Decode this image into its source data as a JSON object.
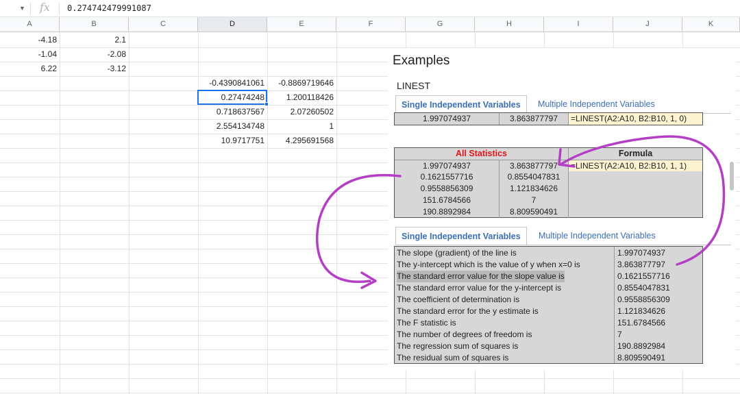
{
  "formula_bar": {
    "fx_label": "fx",
    "value": "0.274742479991087"
  },
  "columns": [
    "A",
    "B",
    "C",
    "D",
    "E",
    "F",
    "G",
    "H",
    "I",
    "J",
    "K"
  ],
  "sheet": {
    "col_a": [
      "-4.18",
      "-1.04",
      "6.22"
    ],
    "col_b": [
      "2.1",
      "-2.08",
      "-3.12"
    ],
    "col_d": [
      "-0.4390841061",
      "0.27474248",
      "0.718637567",
      "2.554134748",
      "10.9717751"
    ],
    "col_e": [
      "-0.8869719646",
      "1.200118426",
      "2.07260502",
      "1",
      "4.295691568"
    ]
  },
  "panel": {
    "title": "Examples",
    "subtitle": "LINEST",
    "tabs_top": {
      "active": "Single Independent Variables",
      "other": "Multiple Independent Variables"
    },
    "simple_row": {
      "v1": "1.997074937",
      "v2": "3.863877797",
      "formula": "=LINEST(A2:A10, B2:B10, 1, 0)"
    },
    "all_stats": {
      "header": "All Statistics",
      "formula_header": "Formula",
      "formula": "=LINEST(A2:A10, B2:B10, 1, 1)",
      "rows": [
        [
          "1.997074937",
          "3.863877797"
        ],
        [
          "0.1621557716",
          "0.8554047831"
        ],
        [
          "0.9558856309",
          "1.121834626"
        ],
        [
          "151.6784566",
          "7"
        ],
        [
          "190.8892984",
          "8.809590491"
        ]
      ]
    },
    "tabs_bottom": {
      "active": "Single Independent Variables",
      "other": "Multiple Independent Variables"
    },
    "explain": [
      [
        "The slope (gradient) of the line is",
        "1.997074937"
      ],
      [
        "The y-intercept which is the value of y when x=0 is",
        "3.863877797"
      ],
      [
        "The standard error value for the slope value is",
        "0.1621557716"
      ],
      [
        "The standard error value for the y-intercept is",
        "0.8554047831"
      ],
      [
        "The coefficient of determination is",
        "0.9558856309"
      ],
      [
        "The standard error for the y estimate is",
        "1.121834626"
      ],
      [
        "The F statistic is",
        "151.6784566"
      ],
      [
        "The number of degrees of freedom is",
        "7"
      ],
      [
        "The regression sum of squares is",
        "190.8892984"
      ],
      [
        "The residual sum of squares is",
        "8.809590491"
      ]
    ]
  },
  "colors": {
    "accent": "#1a73e8",
    "header_red": "#e0141c",
    "tab_blue": "#3b6fb5",
    "annotation": "#b43fc5",
    "formula_bg": "#fdf3d0",
    "table_gray": "#d7d7d7"
  }
}
